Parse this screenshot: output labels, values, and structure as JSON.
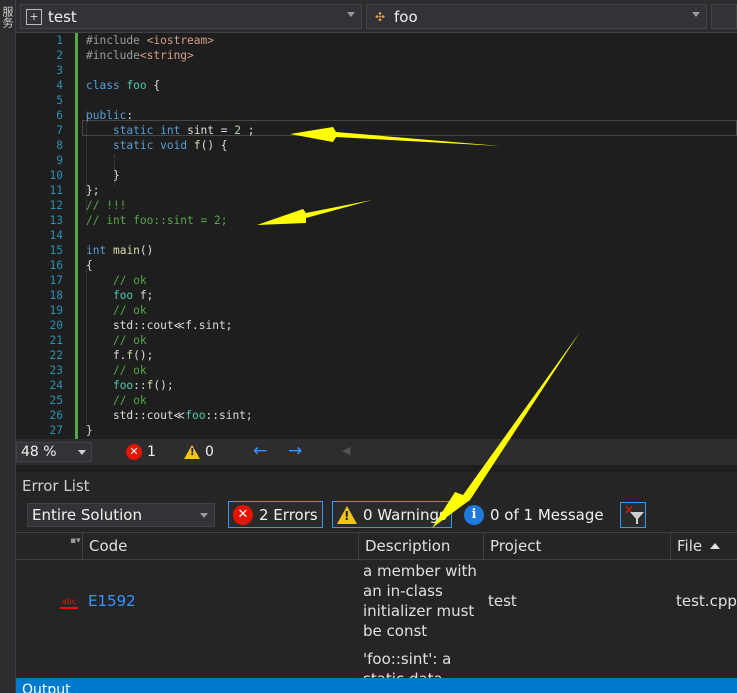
{
  "left_strip": {
    "tab_label": "服务"
  },
  "navbar": {
    "project_combo": "test",
    "scope_combo": "foo",
    "member_combo": ""
  },
  "editor": {
    "lines": [
      {
        "n": "1",
        "html": "<span class=\"pp\">#include</span> <span class=\"st\">&lt;iostream&gt;</span>"
      },
      {
        "n": "2",
        "html": "<span class=\"pp\">#include</span><span class=\"st\">&lt;string&gt;</span>"
      },
      {
        "n": "3",
        "html": ""
      },
      {
        "n": "4",
        "html": "<span class=\"kw\">class</span> <span class=\"ty\">foo</span> {"
      },
      {
        "n": "5",
        "html": ""
      },
      {
        "n": "6",
        "html": "<span class=\"kw\">public</span>:"
      },
      {
        "n": "7",
        "html": "    <span class=\"kw\">static</span> <span class=\"kw\">int</span> sint = <span class=\"nm\">2</span> ;"
      },
      {
        "n": "8",
        "html": "    <span class=\"kw\">static</span> <span class=\"kw\">void</span> <span class=\"fn\">f</span>() {"
      },
      {
        "n": "9",
        "html": ""
      },
      {
        "n": "10",
        "html": "    }"
      },
      {
        "n": "11",
        "html": "};"
      },
      {
        "n": "12",
        "html": "<span class=\"cm\">// !!!</span>"
      },
      {
        "n": "13",
        "html": "<span class=\"cm\">// int foo::sint = 2;</span>"
      },
      {
        "n": "14",
        "html": ""
      },
      {
        "n": "15",
        "html": "<span class=\"kw\">int</span> <span class=\"fn\">main</span>()"
      },
      {
        "n": "16",
        "html": "{"
      },
      {
        "n": "17",
        "html": "    <span class=\"cm\">// ok</span>"
      },
      {
        "n": "18",
        "html": "    <span class=\"ty\">foo</span> f;"
      },
      {
        "n": "19",
        "html": "    <span class=\"cm\">// ok</span>"
      },
      {
        "n": "20",
        "html": "    std::cout≪f.sint;"
      },
      {
        "n": "21",
        "html": "    <span class=\"cm\">// ok</span>"
      },
      {
        "n": "22",
        "html": "    f.<span class=\"fn\">f</span>();"
      },
      {
        "n": "23",
        "html": "    <span class=\"cm\">// ok</span>"
      },
      {
        "n": "24",
        "html": "    <span class=\"ty\">foo</span>::<span class=\"fn\">f</span>();"
      },
      {
        "n": "25",
        "html": "    <span class=\"cm\">// ok</span>"
      },
      {
        "n": "26",
        "html": "    std::cout≪<span class=\"ty\">foo</span>::sint;"
      },
      {
        "n": "27",
        "html": "}"
      }
    ]
  },
  "status": {
    "zoom": "48 %",
    "errors": "1",
    "warnings": "0"
  },
  "error_list": {
    "title": "Error List",
    "scope": "Entire Solution",
    "errors_filter": "2 Errors",
    "warnings_filter": "0 Warnings",
    "messages_filter": "0 of 1 Message",
    "columns": {
      "code": "Code",
      "description": "Description",
      "project": "Project",
      "file": "File"
    },
    "rows": [
      {
        "code": "E1592",
        "description": "a member with an in-class initializer must be const",
        "project": "test",
        "file": "test.cpp"
      },
      {
        "code": "",
        "description": "'foo::sint': a static data",
        "project": "",
        "file": ""
      }
    ]
  },
  "output_tab": {
    "label": "Output"
  },
  "colors": {
    "annotation_arrow": "#ffff00",
    "error_red": "#e51400",
    "accent_blue": "#007acc"
  }
}
